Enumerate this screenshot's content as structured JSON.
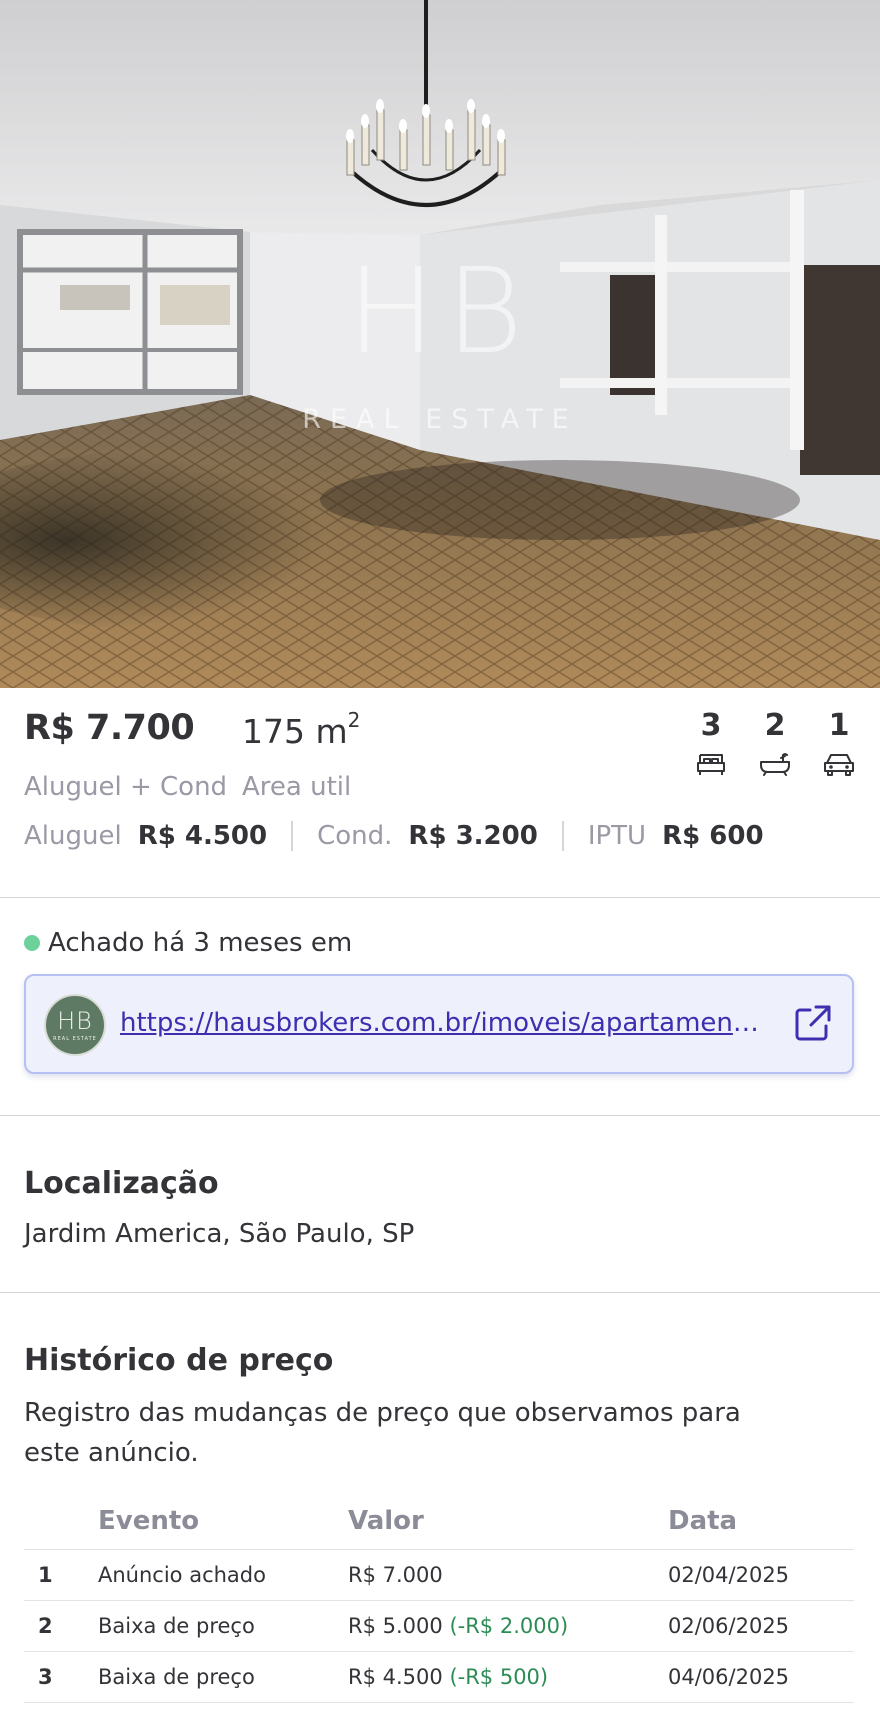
{
  "photo": {
    "watermark_mark": "HB",
    "watermark_text": "REAL ESTATE"
  },
  "listing": {
    "price": "R$ 7.700",
    "price_caption": "Aluguel + Cond",
    "area_value": "175 m",
    "area_exponent": "2",
    "area_caption": "Area util",
    "features": [
      {
        "count": "3",
        "icon": "bed-icon"
      },
      {
        "count": "2",
        "icon": "bathtub-icon"
      },
      {
        "count": "1",
        "icon": "car-icon"
      }
    ],
    "costs": [
      {
        "label": "Aluguel",
        "value": "R$ 4.500"
      },
      {
        "label": "Cond.",
        "value": "R$ 3.200"
      },
      {
        "label": "IPTU",
        "value": "R$ 600"
      }
    ]
  },
  "source": {
    "found_text": "Achado há 3 meses em",
    "status_color": "#6dd29a",
    "logo_mark": "HB",
    "logo_text": "REAL ESTATE",
    "url": "https://hausbrokers.com.br/imoveis/apartamento-...",
    "open_icon": "external-link-icon"
  },
  "location": {
    "title": "Localização",
    "address": "Jardim America, São Paulo, SP"
  },
  "history": {
    "title": "Histórico de preço",
    "description": "Registro das mudanças de preço que observamos para este anúncio.",
    "columns": [
      "",
      "Evento",
      "Valor",
      "Data"
    ],
    "rows": [
      {
        "n": "1",
        "event": "Anúncio achado",
        "value": "R$ 7.000",
        "change": "",
        "date": "02/04/2025"
      },
      {
        "n": "2",
        "event": "Baixa de preço",
        "value": "R$ 5.000",
        "change": "(-R$ 2.000)",
        "date": "02/06/2025"
      },
      {
        "n": "3",
        "event": "Baixa de preço",
        "value": "R$ 4.500",
        "change": "(-R$ 500)",
        "date": "04/06/2025"
      }
    ]
  },
  "colors": {
    "accent_link": "#3d2fb0",
    "price_drop": "#2c8c54",
    "link_card_bg": "#eef0fc"
  }
}
